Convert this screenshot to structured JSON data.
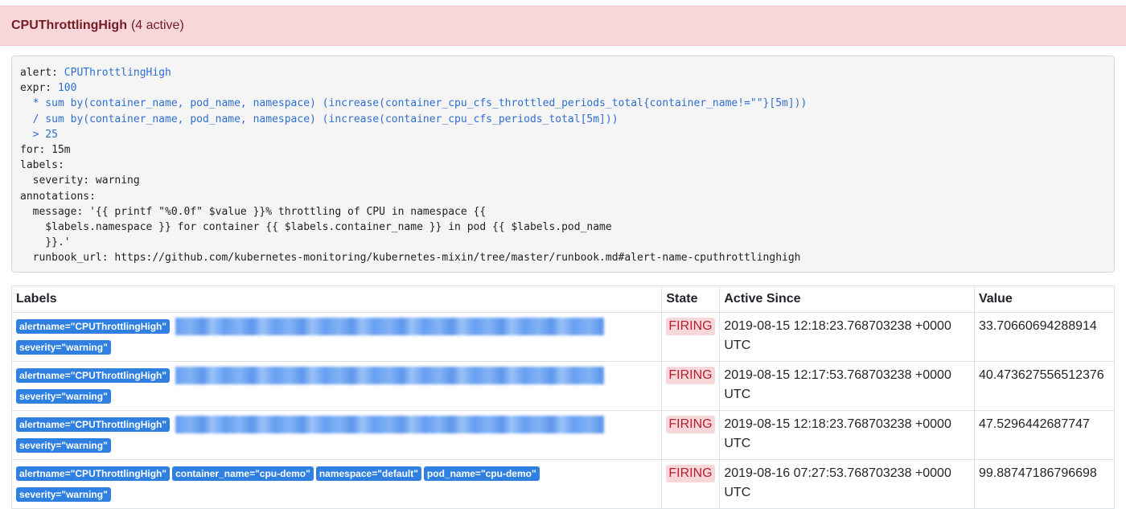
{
  "header": {
    "alert_name": "CPUThrottlingHigh",
    "active_count": "(4 active)"
  },
  "rule": {
    "lines": [
      [
        {
          "t": "alert: "
        },
        {
          "t": "CPUThrottlingHigh",
          "c": "blue"
        }
      ],
      [
        {
          "t": "expr: "
        },
        {
          "t": "100",
          "c": "blue"
        }
      ],
      [
        {
          "t": "  * sum by(container_name, pod_name, namespace) (increase(container_cpu_cfs_throttled_periods_total{container_name!=\"\"}[5m]))",
          "c": "blue"
        }
      ],
      [
        {
          "t": "  / sum by(container_name, pod_name, namespace) (increase(container_cpu_cfs_periods_total[5m]))",
          "c": "blue"
        }
      ],
      [
        {
          "t": "  > 25",
          "c": "blue"
        }
      ],
      [
        {
          "t": "for: 15m"
        }
      ],
      [
        {
          "t": "labels:"
        }
      ],
      [
        {
          "t": "  severity: warning"
        }
      ],
      [
        {
          "t": "annotations:"
        }
      ],
      [
        {
          "t": "  message: '{{ printf \"%0.0f\" $value }}% throttling of CPU in namespace {{"
        }
      ],
      [
        {
          "t": "    $labels.namespace }} for container {{ $labels.container_name }} in pod {{ $labels.pod_name"
        }
      ],
      [
        {
          "t": "    }}.'"
        }
      ],
      [
        {
          "t": "  runbook_url: https://github.com/kubernetes-monitoring/kubernetes-mixin/tree/master/runbook.md#alert-name-cputhrottlinghigh"
        }
      ]
    ]
  },
  "table": {
    "headers": [
      "Labels",
      "State",
      "Active Since",
      "Value"
    ],
    "rows": [
      {
        "labels": [
          "alertname=\"CPUThrottlingHigh\""
        ],
        "redacted": true,
        "labels2": [
          "severity=\"warning\""
        ],
        "state": "FIRING",
        "active_since": "2019-08-15 12:18:23.768703238 +0000 UTC",
        "value": "33.70660694288914"
      },
      {
        "labels": [
          "alertname=\"CPUThrottlingHigh\""
        ],
        "redacted": true,
        "labels2": [
          "severity=\"warning\""
        ],
        "state": "FIRING",
        "active_since": "2019-08-15 12:17:53.768703238 +0000 UTC",
        "value": "40.473627556512376"
      },
      {
        "labels": [
          "alertname=\"CPUThrottlingHigh\""
        ],
        "redacted": true,
        "labels2": [
          "severity=\"warning\""
        ],
        "state": "FIRING",
        "active_since": "2019-08-15 12:18:23.768703238 +0000 UTC",
        "value": "47.5296442687747"
      },
      {
        "labels": [
          "alertname=\"CPUThrottlingHigh\"",
          "container_name=\"cpu-demo\"",
          "namespace=\"default\"",
          "pod_name=\"cpu-demo\""
        ],
        "redacted": false,
        "labels2": [
          "severity=\"warning\""
        ],
        "state": "FIRING",
        "active_since": "2019-08-16 07:27:53.768703238 +0000 UTC",
        "value": "99.88747186796698"
      }
    ]
  },
  "colors": {
    "header_bg": "#f8d7da",
    "header_text": "#721c24",
    "badge": "#2f80e0",
    "firing_bg": "#f8d7da",
    "firing_text": "#b3202e",
    "code_accent": "#2f6fcf"
  }
}
